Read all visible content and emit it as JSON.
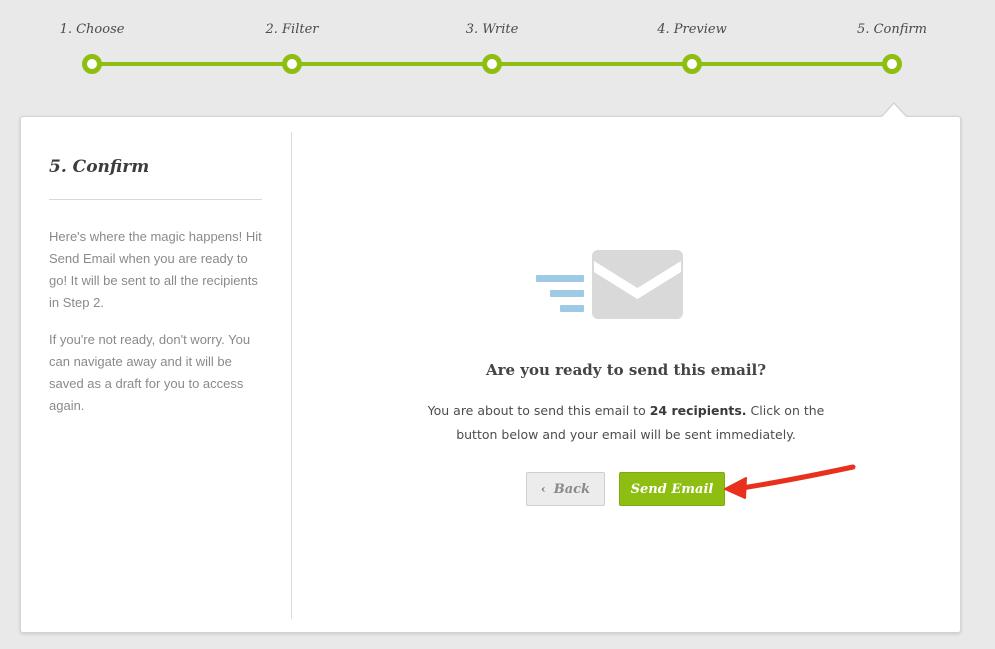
{
  "steps": [
    {
      "label": "1. Choose"
    },
    {
      "label": "2. Filter"
    },
    {
      "label": "3. Write"
    },
    {
      "label": "4. Preview"
    },
    {
      "label": "5. Confirm"
    }
  ],
  "active_step": 5,
  "sidebar": {
    "title": "5. Confirm",
    "paragraph1": "Here's where the magic happens! Hit Send Email when you are ready to go! It will be sent to all the recipients in Step 2.",
    "paragraph2": "If you're not ready, don't worry. You can navigate away and it will be saved as a draft for you to access again."
  },
  "main": {
    "icon": "envelope-send-icon",
    "question": "Are you ready to send this email?",
    "desc_prefix": "You are about to send this email to ",
    "desc_count": "24 recipients.",
    "desc_suffix": " Click on the button below and your email will be sent immediately.",
    "back_label": "Back",
    "send_label": "Send Email"
  },
  "colors": {
    "accent": "#8fbe12",
    "annotation_arrow": "#e8301c",
    "envelope": "#d9d9d9",
    "speed_lines": "#9ecae6"
  }
}
